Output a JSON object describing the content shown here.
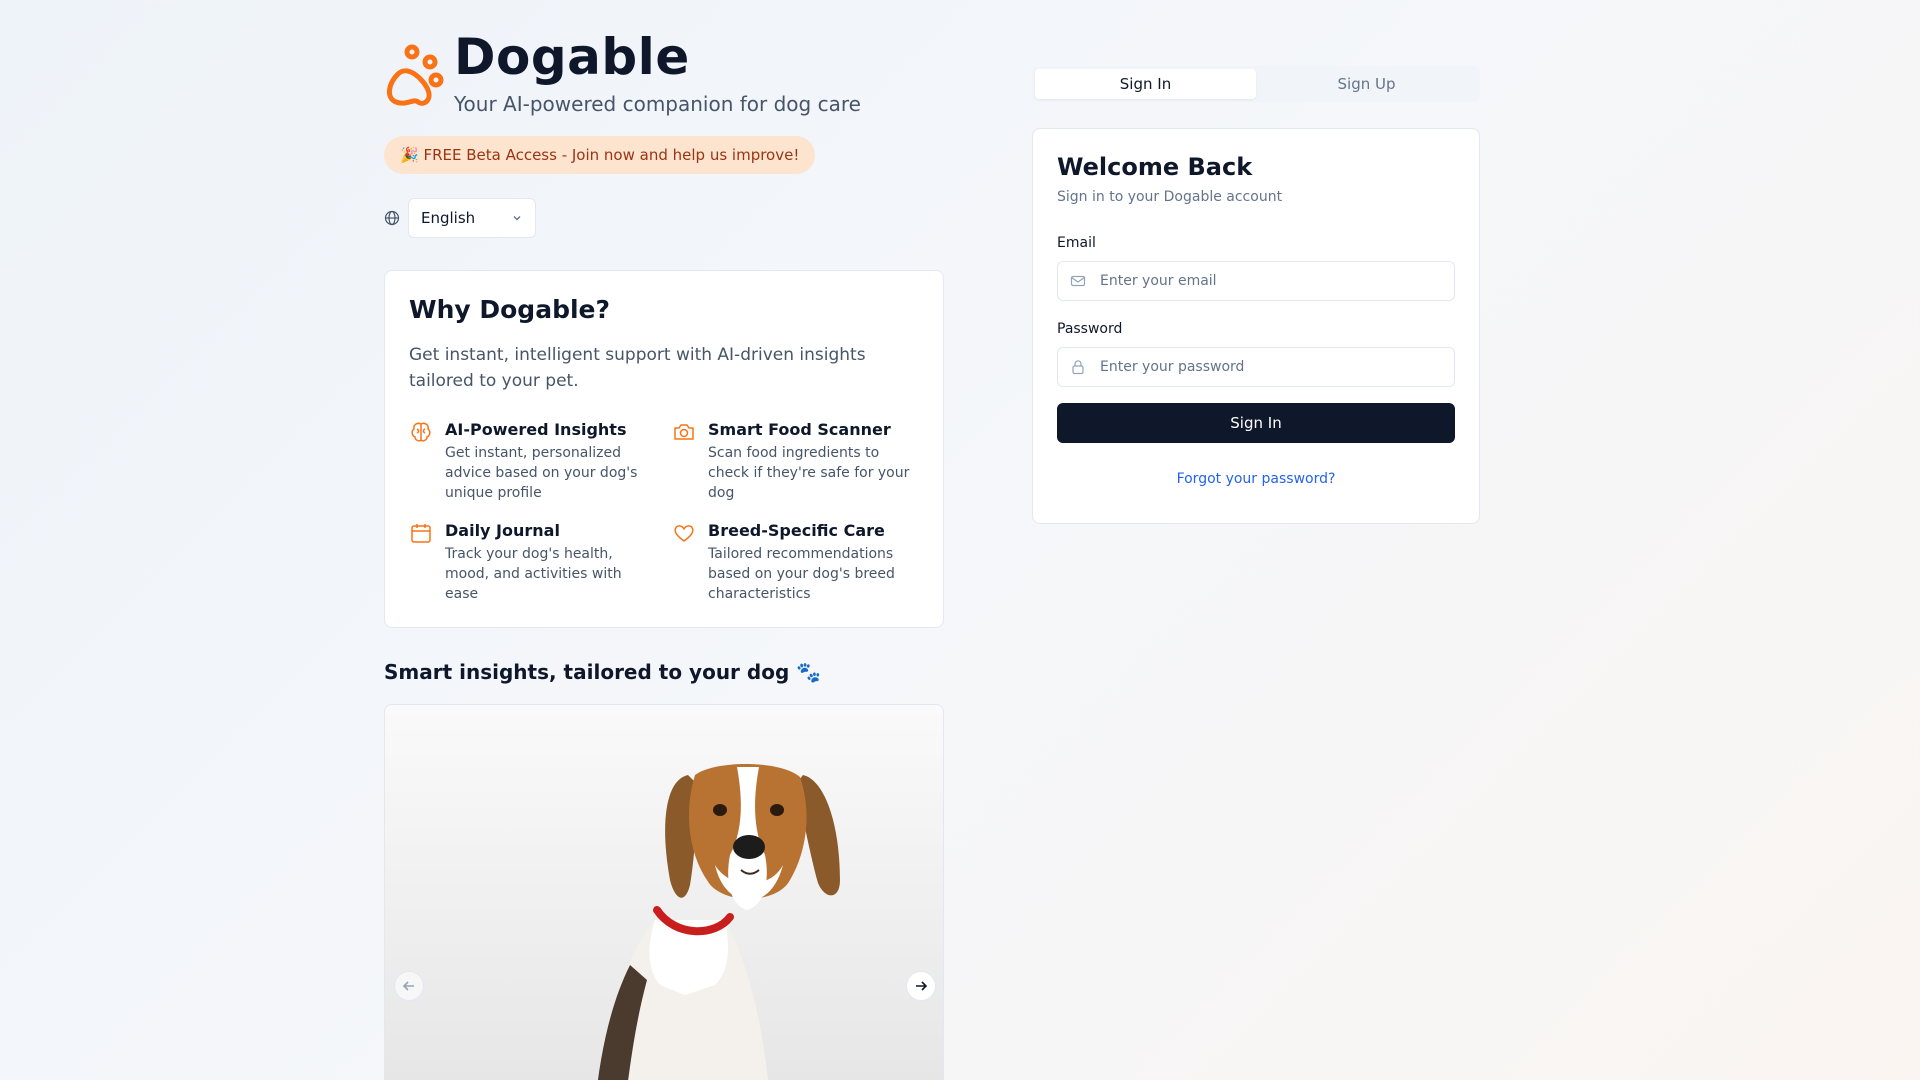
{
  "brand": {
    "title": "Dogable",
    "subtitle": "Your AI-powered companion for dog care",
    "accent": "#f97316"
  },
  "beta_banner": "🎉 FREE Beta Access - Join now and help us improve!",
  "language": {
    "icon": "globe-icon",
    "selected": "English"
  },
  "why": {
    "title": "Why Dogable?",
    "description": "Get instant, intelligent support with AI-driven insights tailored to your pet.",
    "features": [
      {
        "icon": "brain-icon",
        "title": "AI-Powered Insights",
        "description": "Get instant, personalized advice based on your dog's unique profile"
      },
      {
        "icon": "camera-icon",
        "title": "Smart Food Scanner",
        "description": "Scan food ingredients to check if they're safe for your dog"
      },
      {
        "icon": "calendar-icon",
        "title": "Daily Journal",
        "description": "Track your dog's health, mood, and activities with ease"
      },
      {
        "icon": "heart-icon",
        "title": "Breed-Specific Care",
        "description": "Tailored recommendations based on your dog's breed characteristics"
      }
    ]
  },
  "insights_heading": "Smart insights, tailored to your dog 🐾",
  "tabs": [
    {
      "label": "Sign In",
      "active": true
    },
    {
      "label": "Sign Up",
      "active": false
    }
  ],
  "signin": {
    "title": "Welcome Back",
    "subtitle": "Sign in to your Dogable account",
    "email_label": "Email",
    "email_placeholder": "Enter your email",
    "password_label": "Password",
    "password_placeholder": "Enter your password",
    "submit_label": "Sign In",
    "forgot_label": "Forgot your password?"
  }
}
